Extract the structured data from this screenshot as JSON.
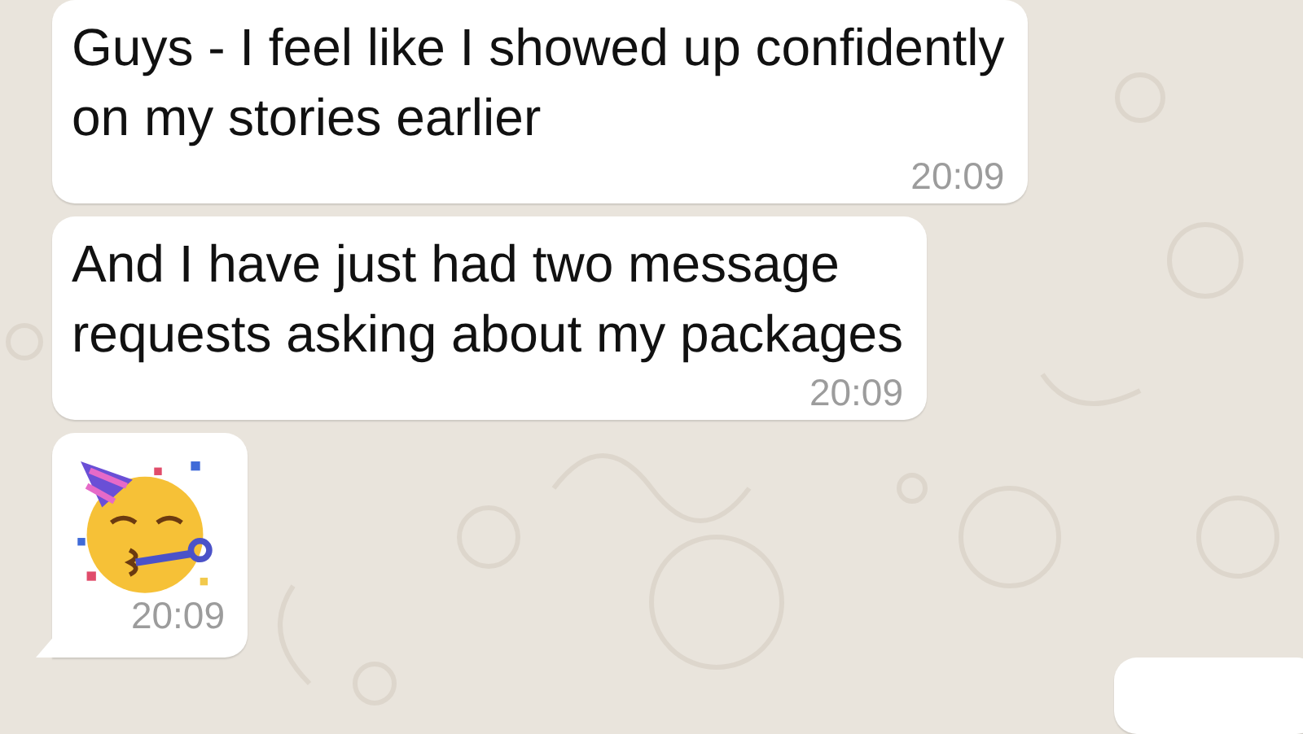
{
  "messages": [
    {
      "kind": "text",
      "text": "Guys - I feel like I showed up confidently\non my stories earlier",
      "time": "20:09",
      "tail": false
    },
    {
      "kind": "text",
      "text": "And I have just had two message\nrequests asking about my packages",
      "time": "20:09",
      "tail": false
    },
    {
      "kind": "emoji",
      "time": "20:09",
      "tail": true
    },
    {
      "kind": "partial",
      "tail": false
    }
  ]
}
